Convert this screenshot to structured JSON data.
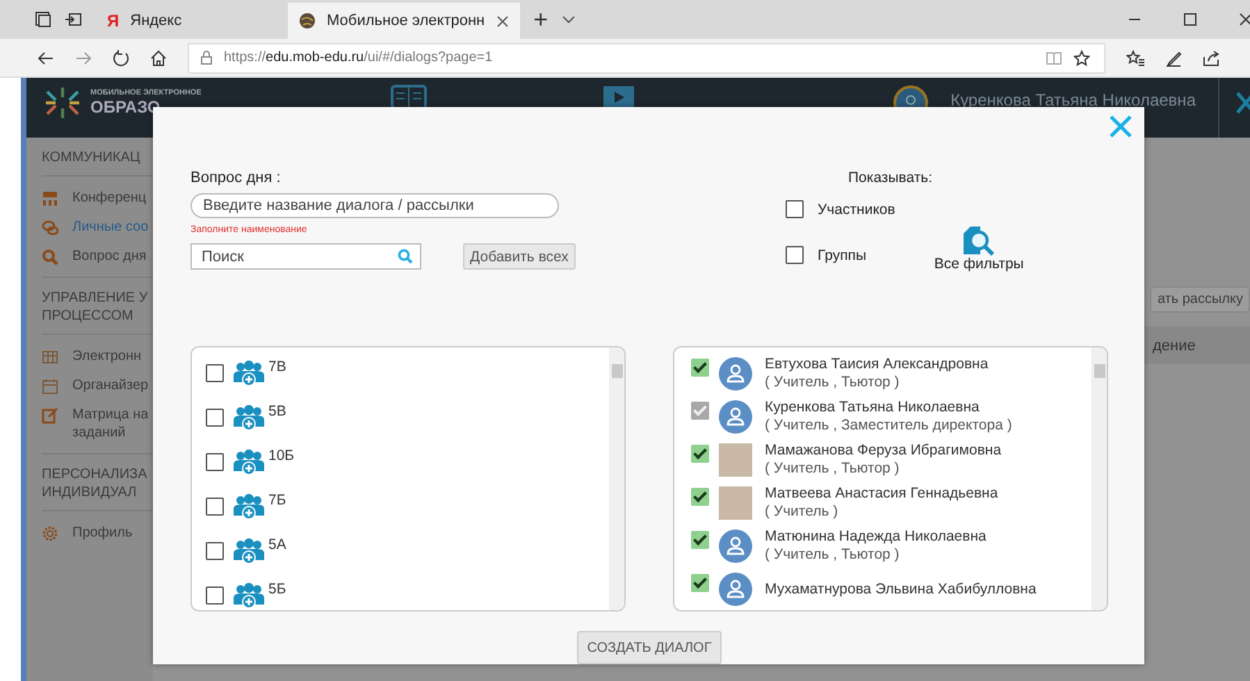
{
  "browser": {
    "tabs": [
      {
        "favicon": "Я",
        "title": "Яндекс",
        "selected": false
      },
      {
        "title": "Мобильное электронн",
        "selected": true
      }
    ],
    "new_tab": "+",
    "url": "https://**edu.mob-edu.ru**/ui/#/dialogs?page=1"
  },
  "header": {
    "logo_small": "МОБИЛЬНОЕ ЭЛЕКТРОННОЕ",
    "logo": "ОБРАЗО",
    "user": "Куренкова Татьяна Николаевна"
  },
  "sidebar": {
    "sections": [
      {
        "title": "КОММУНИКАЦ",
        "items": [
          {
            "label": "Конференц",
            "kind": "conference",
            "selected": false
          },
          {
            "label": "Личные соо",
            "kind": "chat",
            "selected": true
          },
          {
            "label": "Вопрос дня",
            "kind": "search",
            "selected": false
          }
        ]
      },
      {
        "title": "УПРАВЛЕНИЕ У\nПРОЦЕССОМ",
        "items": [
          {
            "label": "Электронн",
            "kind": "grid",
            "selected": false
          },
          {
            "label": "Органайзер",
            "kind": "calendar",
            "selected": false
          },
          {
            "label": "Матрица на\nзаданий",
            "kind": "edit",
            "selected": false
          }
        ]
      },
      {
        "title": "ПЕРСОНАЛИЗА\nИНДИВИДУАЛ",
        "items": [
          {
            "label": "Профиль",
            "kind": "gear",
            "selected": false
          }
        ]
      }
    ]
  },
  "background": {
    "button": "ать рассылку",
    "column": "дение"
  },
  "dialog": {
    "label": "Вопрос дня :",
    "title_field": {
      "placeholder": "Введите название диалога / рассылки"
    },
    "error": "Заполните наименование",
    "search": {
      "placeholder": "Поиск"
    },
    "add_all": "Добавить всех",
    "show_label": "Показывать:",
    "show_options": [
      {
        "label": "Участников",
        "checked": false
      },
      {
        "label": "Группы",
        "checked": false
      }
    ],
    "filters": "Все фильтры",
    "groups": [
      {
        "name": "7В",
        "checked": false
      },
      {
        "name": "5В",
        "checked": false
      },
      {
        "name": "10Б",
        "checked": false
      },
      {
        "name": "7Б",
        "checked": false
      },
      {
        "name": "5А",
        "checked": false
      },
      {
        "name": "5Б",
        "checked": false
      }
    ],
    "participants": [
      {
        "name": "Евтухова Таисия Александровна",
        "roles": "( Учитель , Тьютор )",
        "checked": true,
        "disabled": false,
        "kind": "avatar"
      },
      {
        "name": "Куренкова Татьяна Николаевна",
        "roles": "( Учитель , Заместитель директора )",
        "checked": true,
        "disabled": true,
        "kind": "avatar"
      },
      {
        "name": "Мамажанова Феруза Ибрагимовна",
        "roles": "( Учитель , Тьютор )",
        "checked": true,
        "disabled": false,
        "kind": "photo"
      },
      {
        "name": "Матвеева Анастасия Геннадьевна",
        "roles": "( Учитель )",
        "checked": true,
        "disabled": false,
        "kind": "photo"
      },
      {
        "name": "Матюнина Надежда Николаевна",
        "roles": "( Учитель , Тьютор )",
        "checked": true,
        "disabled": false,
        "kind": "avatar"
      },
      {
        "name": "Мухаматнурова Эльвина Хабибулловна",
        "checked": true,
        "disabled": false,
        "kind": "avatar"
      }
    ],
    "create": "СОЗДАТЬ ДИАЛОГ"
  }
}
